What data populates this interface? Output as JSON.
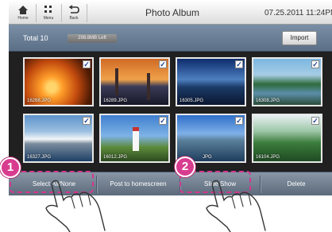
{
  "nav": [
    {
      "label": "Home",
      "icon": "home-icon"
    },
    {
      "label": "Menu",
      "icon": "menu-grid-icon"
    },
    {
      "label": "Back",
      "icon": "back-arrow-icon"
    }
  ],
  "app_title": "Photo Album",
  "clock": "07.25.2011 11:24PM",
  "toolbar": {
    "total": "Total 10",
    "storage": "298.8MB Left",
    "import_label": "Import"
  },
  "photos": [
    {
      "name": "16268.JPG",
      "checked": true
    },
    {
      "name": "16289.JPG",
      "checked": true
    },
    {
      "name": "16305.JPG",
      "checked": true
    },
    {
      "name": "16308.JPG",
      "checked": true
    },
    {
      "name": "16327.JPG",
      "checked": true
    },
    {
      "name": "16012.JPG",
      "checked": true
    },
    {
      "name": "JPG",
      "checked": true
    },
    {
      "name": "16104.JPG",
      "checked": true
    }
  ],
  "actions": {
    "select_all": "Select All/None",
    "post_home": "Post to homescreen",
    "slide_show": "Slide Show",
    "delete": "Delete"
  },
  "callouts": [
    "1",
    "2"
  ],
  "colors": {
    "accent": "#d83c8f",
    "toolbar": "#6b7f95",
    "action_bar": "#7a8898"
  }
}
